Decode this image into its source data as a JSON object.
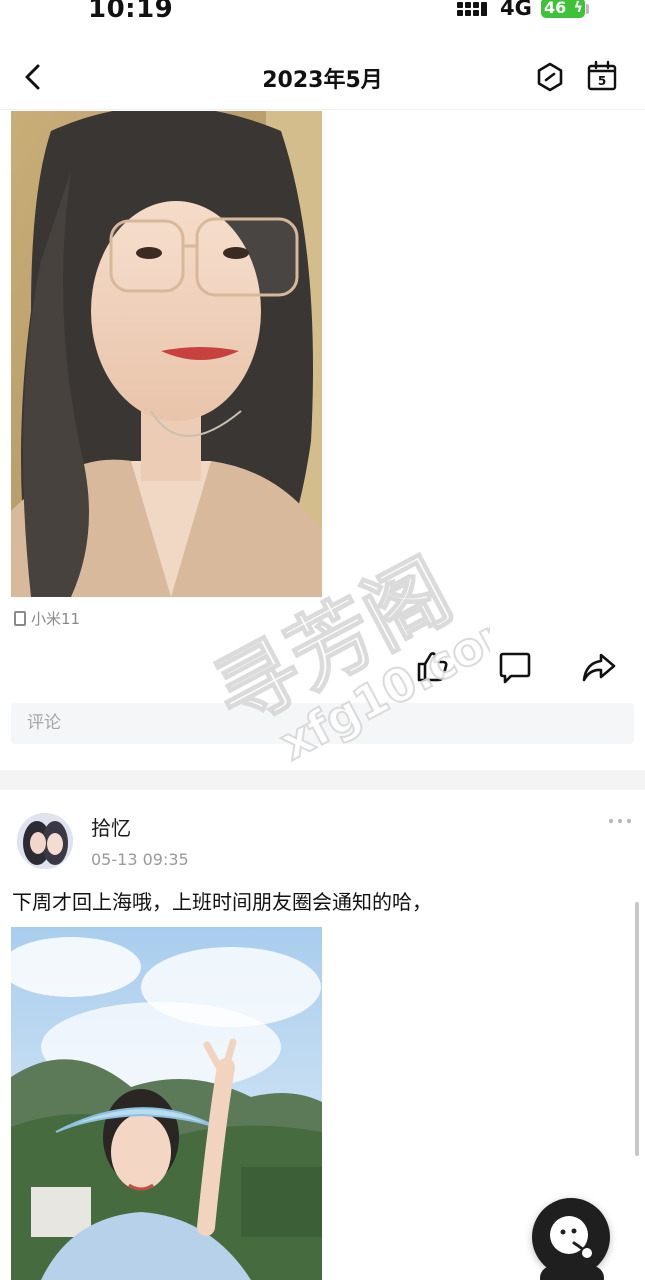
{
  "status_bar": {
    "time": "10:19",
    "network": "4G",
    "battery": "46"
  },
  "header": {
    "title": "2023年5月",
    "calendar_day": "5"
  },
  "posts": [
    {
      "device": "小米11",
      "comment_placeholder": "评论"
    },
    {
      "username": "拾忆",
      "timestamp": "05-13 09:35",
      "text": "下周才回上海哦，上班时间朋友圈会通知的哈，"
    }
  ],
  "watermark": {
    "line1": "寻芳阁",
    "line2": "xfg10.com"
  },
  "icons": {
    "back": "chevron-left-icon",
    "hexagon": "hexagon-icon",
    "calendar": "calendar-icon",
    "like": "thumbs-up-icon",
    "comment": "comment-icon",
    "share": "share-icon",
    "more": "more-icon",
    "fab": "emoji-icon"
  },
  "colors": {
    "battery": "#3ec23a",
    "fab": "#1f1f1f",
    "muted_text": "#9a9a9a"
  }
}
